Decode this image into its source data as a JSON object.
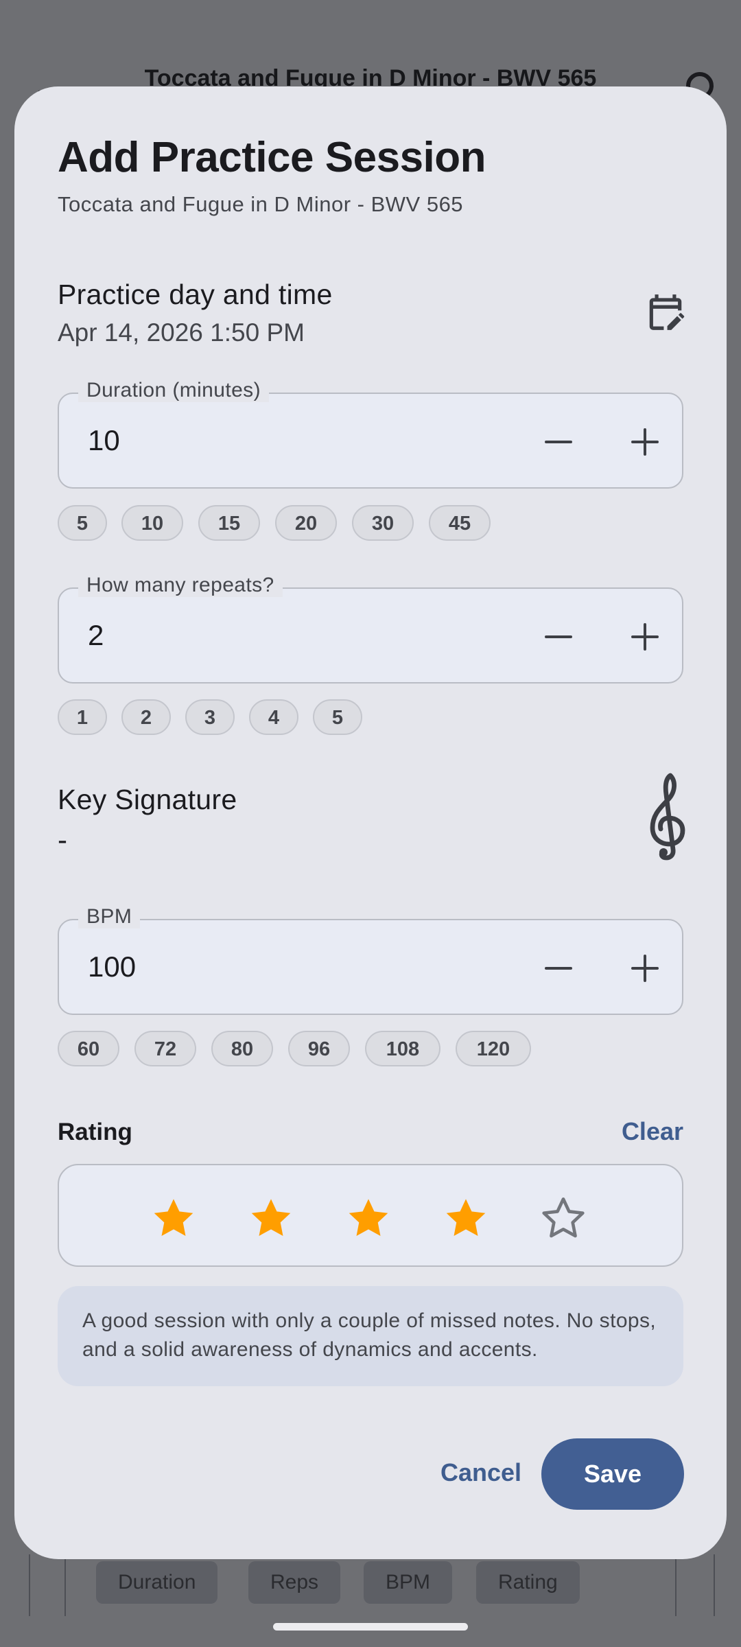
{
  "background": {
    "title": "Toccata and Fugue in D Minor - BWV 565",
    "tabs": [
      "Duration",
      "Reps",
      "BPM",
      "Rating"
    ]
  },
  "dialog": {
    "title": "Add Practice Session",
    "subtitle": "Toccata and Fugue in D Minor - BWV 565",
    "practice": {
      "label": "Practice day and time",
      "value": "Apr 14, 2026 1:50 PM",
      "icon": "calendar-edit-icon"
    },
    "duration": {
      "legend": "Duration (minutes)",
      "value": "10",
      "chips": [
        "5",
        "10",
        "15",
        "20",
        "30",
        "45"
      ]
    },
    "repeats": {
      "legend": "How many repeats?",
      "value": "2",
      "chips": [
        "1",
        "2",
        "3",
        "4",
        "5"
      ]
    },
    "key": {
      "label": "Key Signature",
      "value": "-",
      "icon": "treble-clef-icon"
    },
    "bpm": {
      "legend": "BPM",
      "value": "100",
      "chips": [
        "60",
        "72",
        "80",
        "96",
        "108",
        "120"
      ]
    },
    "rating": {
      "label": "Rating",
      "clear_label": "Clear",
      "value": 4,
      "max": 5,
      "filled_color": "#ff9e00",
      "empty_color": "#73767c",
      "description": "A good session with only a couple of missed notes. No stops, and a solid awareness of dynamics and accents."
    },
    "actions": {
      "cancel_label": "Cancel",
      "save_label": "Save"
    }
  },
  "colors": {
    "accent": "#425f93",
    "sheet_bg": "#e5e6ec",
    "scrim": "#6e6f73"
  }
}
